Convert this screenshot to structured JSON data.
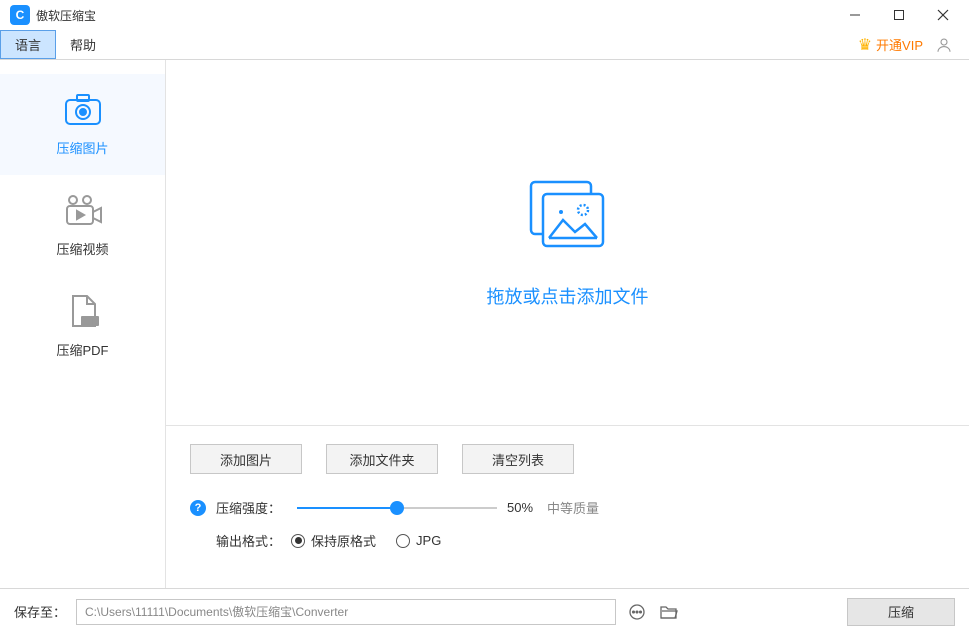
{
  "window": {
    "title": "傲软压缩宝"
  },
  "menu": {
    "language": "语言",
    "help": "帮助",
    "vip": "开通VIP"
  },
  "sidebar": {
    "items": [
      {
        "label": "压缩图片"
      },
      {
        "label": "压缩视频"
      },
      {
        "label": "压缩PDF"
      }
    ]
  },
  "main": {
    "drop_text": "拖放或点击添加文件"
  },
  "buttons": {
    "add_image": "添加图片",
    "add_folder": "添加文件夹",
    "clear_list": "清空列表"
  },
  "options": {
    "strength_label": "压缩强度：",
    "strength_value": "50%",
    "quality_label": "中等质量",
    "output_label": "输出格式：",
    "radio_keep": "保持原格式",
    "radio_jpg": "JPG"
  },
  "footer": {
    "save_label": "保存至：",
    "path": "C:\\Users\\11111\\Documents\\傲软压缩宝\\Converter",
    "compress": "压缩"
  }
}
